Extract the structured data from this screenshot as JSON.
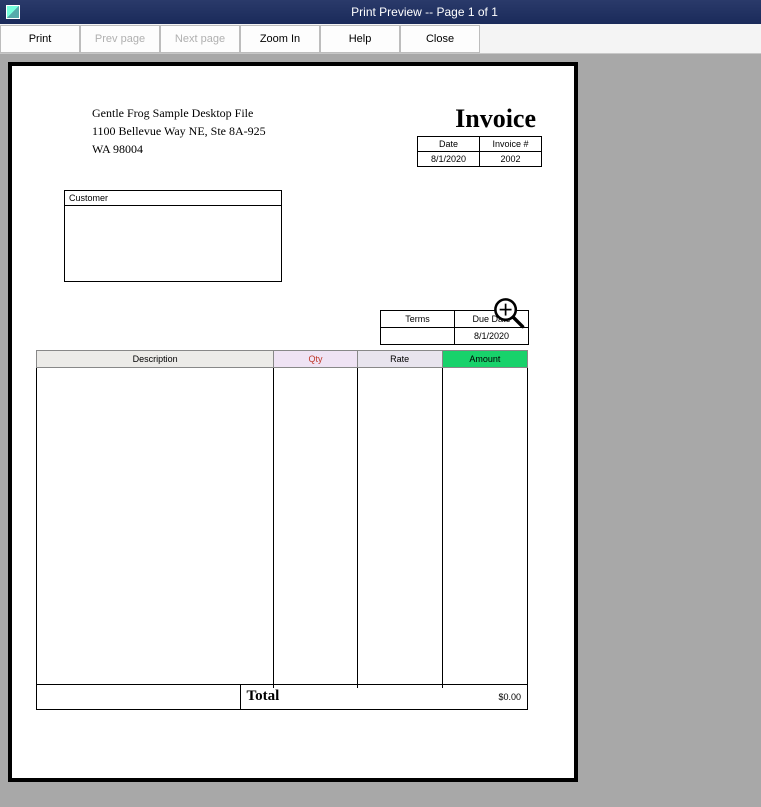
{
  "window": {
    "title": "Print Preview -- Page 1 of 1"
  },
  "toolbar": {
    "print": "Print",
    "prev": "Prev page",
    "next": "Next page",
    "zoom": "Zoom In",
    "help": "Help",
    "close": "Close"
  },
  "invoice": {
    "company_name": "Gentle Frog Sample Desktop File",
    "company_addr1": "1100 Bellevue Way NE, Ste 8A-925",
    "company_addr2": "WA 98004",
    "title": "Invoice",
    "meta": {
      "date_label": "Date",
      "invoice_num_label": "Invoice #",
      "date": "8/1/2020",
      "invoice_num": "2002"
    },
    "customer_label": "Customer",
    "terms_label": "Terms",
    "due_label": "Due Date",
    "terms": "",
    "due": "8/1/2020",
    "columns": {
      "description": "Description",
      "qty": "Qty",
      "rate": "Rate",
      "amount": "Amount"
    },
    "total_label": "Total",
    "total_value": "$0.00"
  },
  "icons": {
    "magnifier": "zoom-in-icon"
  }
}
